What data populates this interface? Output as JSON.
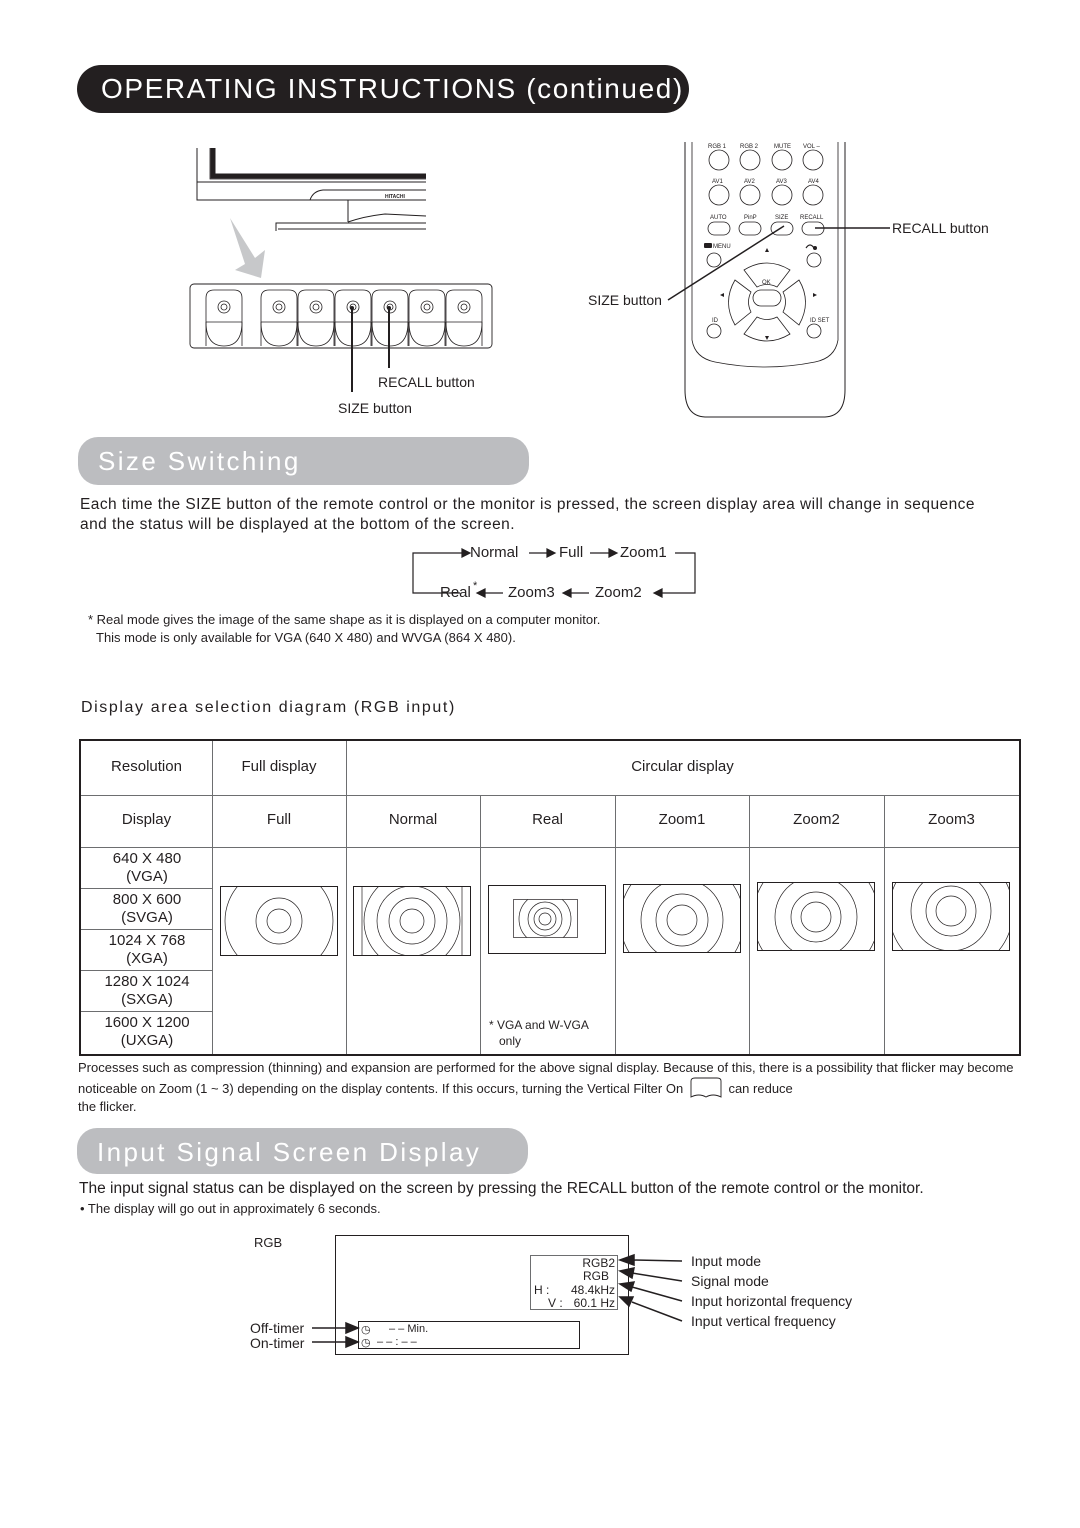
{
  "header": {
    "title": "OPERATING INSTRUCTIONS (continued)"
  },
  "monitor_figure": {
    "brand": "HITACHI",
    "callouts": {
      "recall": "RECALL button",
      "size": "SIZE button"
    }
  },
  "remote_figure": {
    "buttons_row1": [
      "RGB 1",
      "RGB 2",
      "MUTE",
      "VOL –"
    ],
    "buttons_row2": [
      "AV1",
      "AV2",
      "AV3",
      "AV4"
    ],
    "buttons_row3": [
      "AUTO",
      "PinP",
      "SIZE",
      "RECALL"
    ],
    "menu_label": "MENU",
    "ok_label": "OK",
    "id_label": "ID",
    "id_set_label": "ID SET",
    "callouts": {
      "recall": "RECALL button",
      "size": "SIZE button"
    }
  },
  "size_switching": {
    "title": "Size Switching",
    "description": "Each time the SIZE button of the remote control or the monitor is pressed, the screen display area will change in sequence and the status will be displayed at the bottom of the screen.",
    "flow": {
      "top_row": [
        "Normal",
        "Full",
        "Zoom1"
      ],
      "bottom_row": [
        "Real",
        "Zoom3",
        "Zoom2"
      ],
      "asterisk": "*"
    },
    "footnote_line1": "* Real mode gives the image of the same shape as it is displayed on a computer monitor.",
    "footnote_line2": "This mode is only available for VGA (640 X 480) and WVGA (864 X 480)."
  },
  "display_area": {
    "heading": "Display area selection diagram (RGB input)",
    "header_row1": {
      "resolution": "Resolution",
      "full_display": "Full display",
      "circular_display": "Circular display"
    },
    "header_row2": [
      "Display",
      "Full",
      "Normal",
      "Real",
      "Zoom1",
      "Zoom2",
      "Zoom3"
    ],
    "resolutions": [
      {
        "size": "640 X 480",
        "name": "(VGA)"
      },
      {
        "size": "800 X 600",
        "name": "(SVGA)"
      },
      {
        "size": "1024 X 768",
        "name": "(XGA)"
      },
      {
        "size": "1280 X 1024",
        "name": "(SXGA)"
      },
      {
        "size": "1600 X 1200",
        "name": "(UXGA)"
      }
    ],
    "real_note_line1": "* VGA and W-VGA",
    "real_note_line2": "only",
    "note": "Processes such as compression (thinning) and expansion are performed for the above signal display. Because of this, there is a possibility that flicker may become noticeable on Zoom (1 ~ 3) depending on the display contents. If this occurs, turning the Vertical Filter On",
    "note_after_icon": "can reduce",
    "note_end": "the flicker."
  },
  "input_signal": {
    "title": "Input Signal Screen Display",
    "description": "The input signal status can be displayed on the screen by pressing the RECALL button of the remote control or the monitor.",
    "bullet": "•  The display will go out in approximately 6 seconds.",
    "osd": {
      "caption": "RGB",
      "input_mode": "RGB2",
      "signal_mode": "RGB",
      "h_label": "H :",
      "h_value": "48.4kHz",
      "v_label": "V :",
      "v_value": "60.1  Hz",
      "off_timer_value": "– – Min.",
      "on_timer_value": "– – : – –"
    },
    "callouts": {
      "input_mode": "Input mode",
      "signal_mode": "Signal mode",
      "h_freq": "Input horizontal frequency",
      "v_freq": "Input vertical frequency",
      "off_timer": "Off-timer",
      "on_timer": "On-timer"
    }
  }
}
